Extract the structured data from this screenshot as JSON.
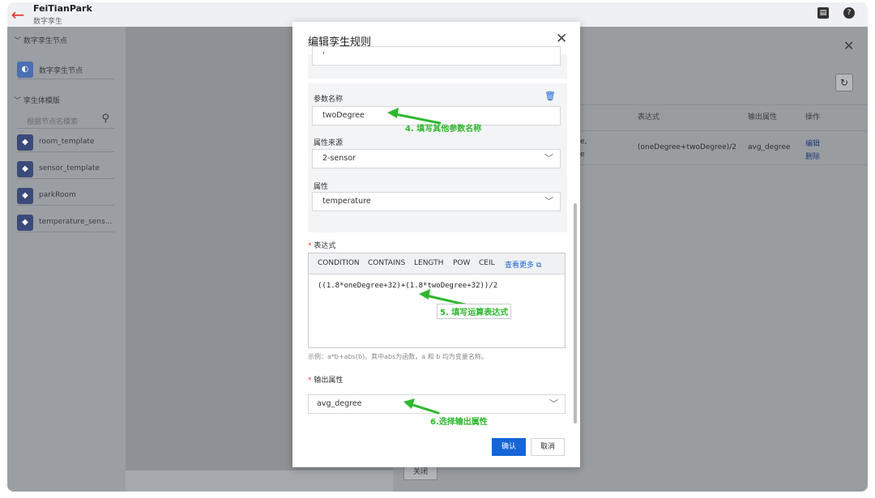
{
  "app": {
    "title": "FeiTianPark",
    "subtitle": "数字孪生"
  },
  "sidebar": {
    "section_nodes": "数字孪生节点",
    "node_item": "数字孪生节点",
    "section_models": "孪生体模版",
    "search_placeholder": "根据节点名模索",
    "models": [
      "room_template",
      "sensor_template",
      "parkRoom",
      "temperature_sens..."
    ]
  },
  "right_panel": {
    "headers": {
      "expression": "表达式",
      "output": "输出属性",
      "action": "操作"
    },
    "row": {
      "fragment_1": "e,",
      "fragment_2": "e",
      "expression": "(oneDegree+twoDegree)/2",
      "output": "avg_degree",
      "edit": "编辑",
      "delete": "删除"
    },
    "close_button": "关闭"
  },
  "modal": {
    "title": "编辑孪生规则",
    "top_input_value": "'",
    "param": {
      "name_label": "参数名称",
      "name_value": "twoDegree",
      "source_label": "属性来源",
      "source_value": "2-sensor",
      "attr_label": "属性",
      "attr_value": "temperature"
    },
    "required_mark": "*",
    "expression": {
      "label": "表达式",
      "tools": [
        "CONDITION",
        "CONTAINS",
        "LENGTH",
        "POW",
        "CEIL"
      ],
      "more": "查看更多",
      "value": "((1.8*oneDegree+32)+(1.8*twoDegree+32))/2",
      "hint": "示例：a*b+abs(b)。其中abs为函数，a 和 b 均为变量名称。"
    },
    "output": {
      "label": "输出属性",
      "value": "avg_degree"
    },
    "confirm": "确认",
    "cancel": "取消"
  },
  "annotations": {
    "step4": "4. 填写其他参数名称",
    "step5": "5. 填写运算表达式",
    "step6": "6.选择输出属性",
    "color": "#2eb82e"
  }
}
